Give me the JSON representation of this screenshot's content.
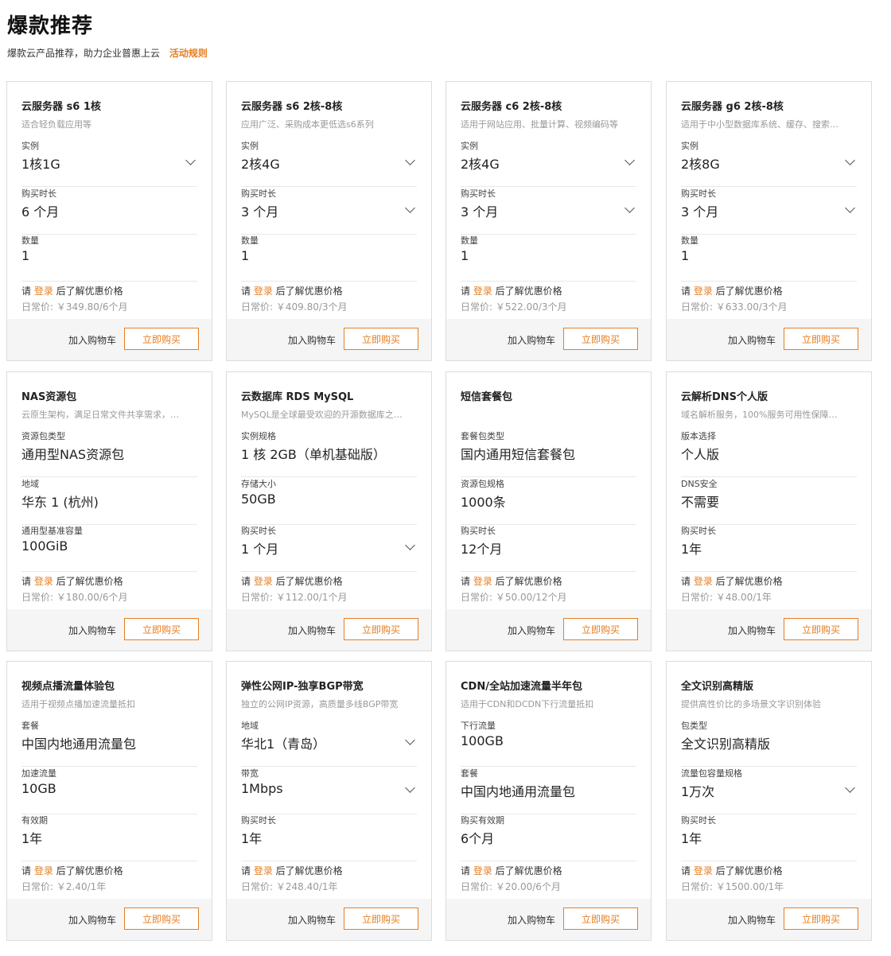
{
  "page": {
    "title": "爆款推荐",
    "subtitle": "爆款云产品推荐，助力企业普惠上云",
    "rules_link": "活动规则",
    "accent_color": "#e67e22"
  },
  "labels": {
    "login_prefix": "请 ",
    "login_link": "登录",
    "login_suffix": " 后了解优惠价格",
    "add_cart": "加入购物车",
    "buy_now": "立即购买"
  },
  "cards": [
    {
      "title": "云服务器 s6 1核",
      "desc": "适合轻负载应用等",
      "fields": [
        {
          "label": "实例",
          "value": "1核1G",
          "dropdown": true
        },
        {
          "label": "购买时长",
          "value": "6 个月",
          "dropdown": false
        },
        {
          "label": "数量",
          "value": "1",
          "dropdown": false
        }
      ],
      "price": "日常价: ￥349.80/6个月"
    },
    {
      "title": "云服务器 s6 2核-8核",
      "desc": "应用广泛、采购成本更低选s6系列",
      "fields": [
        {
          "label": "实例",
          "value": "2核4G",
          "dropdown": true
        },
        {
          "label": "购买时长",
          "value": "3 个月",
          "dropdown": true
        },
        {
          "label": "数量",
          "value": "1",
          "dropdown": false
        }
      ],
      "price": "日常价: ￥409.80/3个月"
    },
    {
      "title": "云服务器 c6 2核-8核",
      "desc": "适用于网站应用、批量计算、视频编码等",
      "fields": [
        {
          "label": "实例",
          "value": "2核4G",
          "dropdown": true
        },
        {
          "label": "购买时长",
          "value": "3 个月",
          "dropdown": true
        },
        {
          "label": "数量",
          "value": "1",
          "dropdown": false
        }
      ],
      "price": "日常价: ￥522.00/3个月"
    },
    {
      "title": "云服务器 g6 2核-8核",
      "desc": "适用于中小型数据库系统、缓存、搜索…",
      "fields": [
        {
          "label": "实例",
          "value": "2核8G",
          "dropdown": true
        },
        {
          "label": "购买时长",
          "value": "3 个月",
          "dropdown": true
        },
        {
          "label": "数量",
          "value": "1",
          "dropdown": false
        }
      ],
      "price": "日常价: ￥633.00/3个月"
    },
    {
      "title": "NAS资源包",
      "desc": "云原生架构，满足日常文件共享需求，…",
      "fields": [
        {
          "label": "资源包类型",
          "value": "通用型NAS资源包",
          "dropdown": false
        },
        {
          "label": "地域",
          "value": "华东 1 (杭州)",
          "dropdown": false
        },
        {
          "label": "通用型基准容量",
          "value": "100GiB",
          "dropdown": false
        }
      ],
      "price": "日常价: ￥180.00/6个月"
    },
    {
      "title": "云数据库 RDS MySQL",
      "desc": "MySQL是全球最受欢迎的开源数据库之…",
      "fields": [
        {
          "label": "实例规格",
          "value": "1 核 2GB（单机基础版）",
          "dropdown": false
        },
        {
          "label": "存储大小",
          "value": "50GB",
          "dropdown": false
        },
        {
          "label": "购买时长",
          "value": "1 个月",
          "dropdown": true
        }
      ],
      "price": "日常价: ￥112.00/1个月"
    },
    {
      "title": "短信套餐包",
      "desc": "",
      "fields": [
        {
          "label": "套餐包类型",
          "value": "国内通用短信套餐包",
          "dropdown": false
        },
        {
          "label": "资源包规格",
          "value": "1000条",
          "dropdown": false
        },
        {
          "label": "购买时长",
          "value": "12个月",
          "dropdown": false
        }
      ],
      "price": "日常价: ￥50.00/12个月"
    },
    {
      "title": "云解析DNS个人版",
      "desc": "域名解析服务，100%服务可用性保障…",
      "fields": [
        {
          "label": "版本选择",
          "value": "个人版",
          "dropdown": false
        },
        {
          "label": "DNS安全",
          "value": "不需要",
          "dropdown": false
        },
        {
          "label": "购买时长",
          "value": "1年",
          "dropdown": false
        }
      ],
      "price": "日常价: ￥48.00/1年"
    },
    {
      "title": "视频点播流量体验包",
      "desc": "适用于视频点播加速流量抵扣",
      "fields": [
        {
          "label": "套餐",
          "value": "中国内地通用流量包",
          "dropdown": false
        },
        {
          "label": "加速流量",
          "value": "10GB",
          "dropdown": false
        },
        {
          "label": "有效期",
          "value": "1年",
          "dropdown": false
        }
      ],
      "price": "日常价: ￥2.40/1年"
    },
    {
      "title": "弹性公网IP-独享BGP带宽",
      "desc": "独立的公网IP资源，高质量多线BGP带宽",
      "fields": [
        {
          "label": "地域",
          "value": "华北1（青岛）",
          "dropdown": true
        },
        {
          "label": "带宽",
          "value": "1Mbps",
          "dropdown": true
        },
        {
          "label": "购买时长",
          "value": "1年",
          "dropdown": false
        }
      ],
      "price": "日常价: ￥248.40/1年"
    },
    {
      "title": "CDN/全站加速流量半年包",
      "desc": "适用于CDN和DCDN下行流量抵扣",
      "fields": [
        {
          "label": "下行流量",
          "value": "100GB",
          "dropdown": false
        },
        {
          "label": "套餐",
          "value": "中国内地通用流量包",
          "dropdown": false
        },
        {
          "label": "购买有效期",
          "value": "6个月",
          "dropdown": false
        }
      ],
      "price": "日常价: ￥20.00/6个月"
    },
    {
      "title": "全文识别高精版",
      "desc": "提供高性价比的多场景文字识别体验",
      "fields": [
        {
          "label": "包类型",
          "value": "全文识别高精版",
          "dropdown": false
        },
        {
          "label": "流量包容量规格",
          "value": "1万次",
          "dropdown": true
        },
        {
          "label": "购买时长",
          "value": "1年",
          "dropdown": false
        }
      ],
      "price": "日常价: ￥1500.00/1年"
    }
  ]
}
